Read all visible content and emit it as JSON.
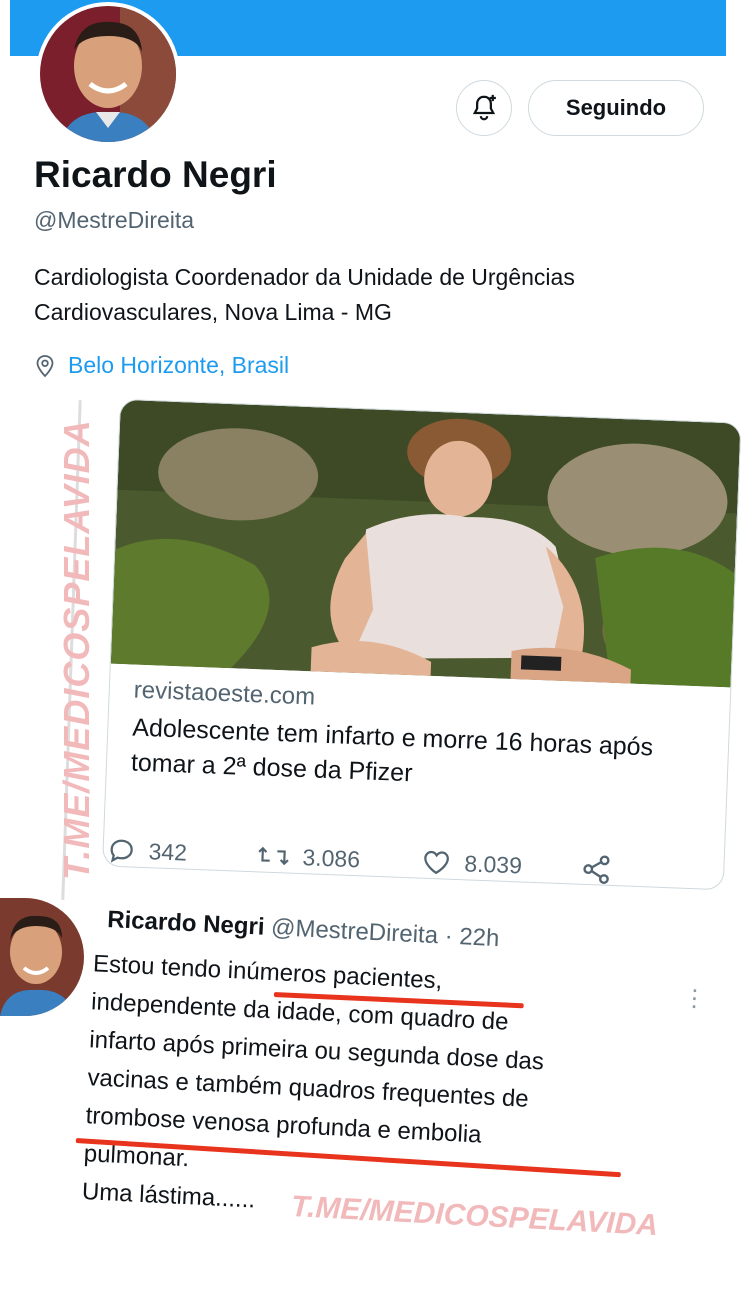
{
  "profile": {
    "name": "Ricardo Negri",
    "handle": "@MestreDireita",
    "bio": "Cardiologista Coordenador da Unidade de Urgências Cardiovasculares, Nova Lima - MG",
    "location": "Belo Horizonte, Brasil",
    "follow_label": "Seguindo"
  },
  "colors": {
    "accent": "#1d9bf0",
    "underline": "#e8341c",
    "watermark": "#f2b9bb"
  },
  "card": {
    "domain": "revistaoeste.com",
    "title": "Adolescente tem infarto e morre 16 horas após tomar a 2ª dose da Pfizer"
  },
  "actions": {
    "replies": "342",
    "retweets": "3.086",
    "likes": "8.039"
  },
  "reply": {
    "name": "Ricardo Negri",
    "handle": "@MestreDireita · 22h",
    "body": "Estou tendo inúmeros pacientes,\nindependente da idade, com quadro de\ninfarto após primeira ou segunda dose das\nvacinas e também quadros frequentes de\ntrombose venosa profunda e embolia\npulmonar.\nUma lástima......"
  },
  "watermarks": {
    "vertical": "T.ME/MEDICOSPELAVIDA",
    "bottom": "T.ME/MEDICOSPELAVIDA"
  },
  "icons": [
    "bell-plus-icon",
    "location-pin-icon",
    "reply-icon",
    "retweet-icon",
    "like-icon",
    "share-icon",
    "more-icon"
  ]
}
